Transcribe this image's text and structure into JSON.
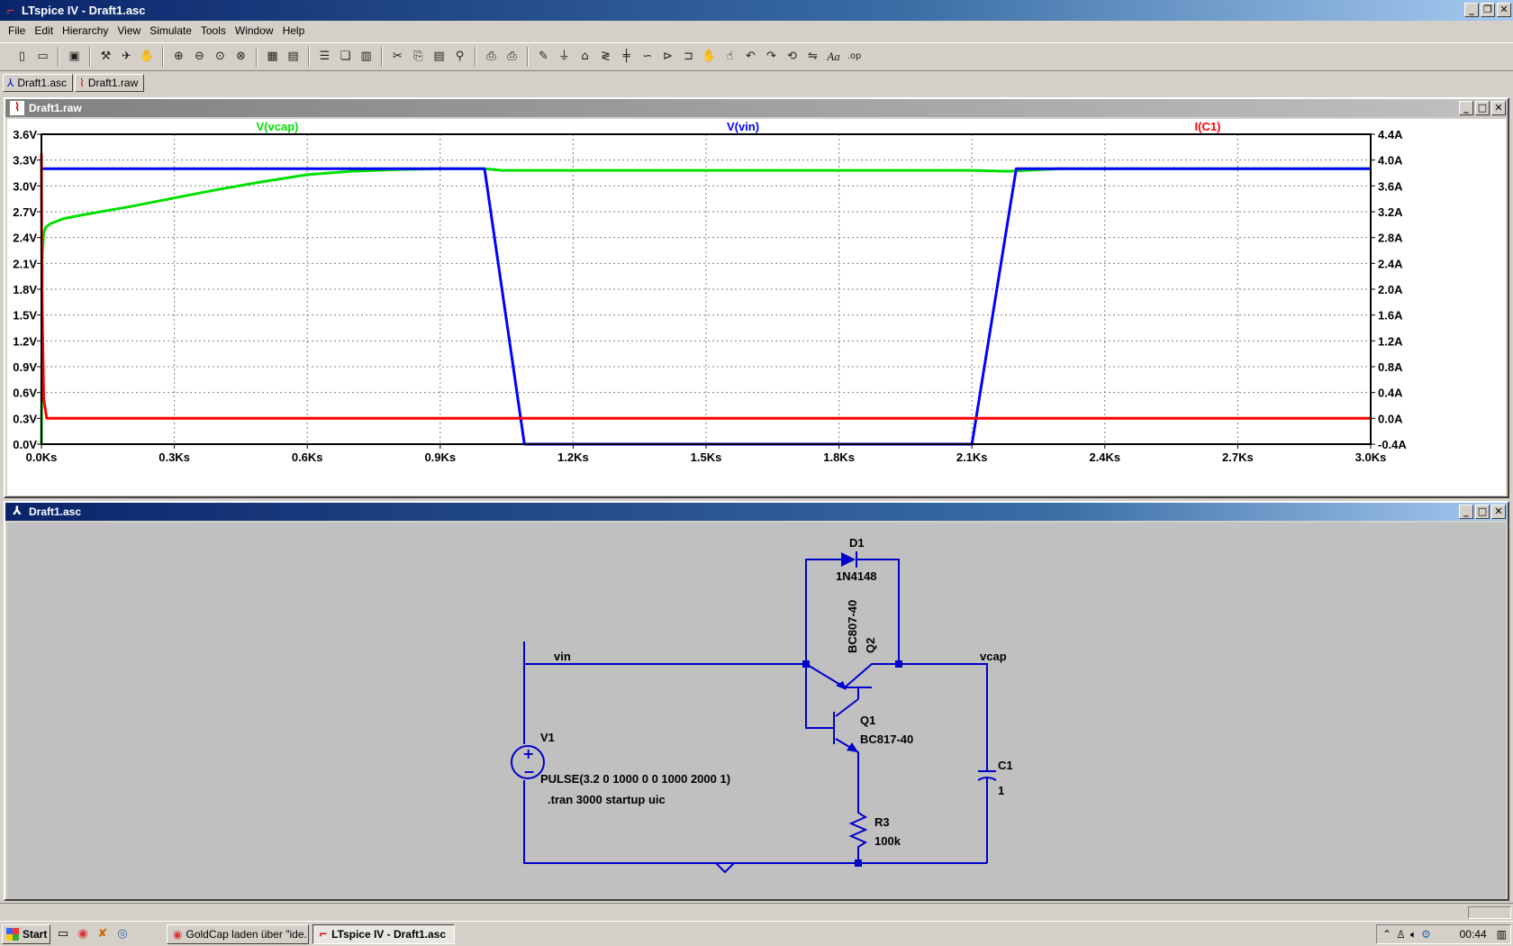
{
  "window": {
    "title": "LTspice IV - Draft1.asc"
  },
  "menu": [
    "File",
    "Edit",
    "Hierarchy",
    "View",
    "Simulate",
    "Tools",
    "Window",
    "Help"
  ],
  "toolbar_icons": [
    "new-schematic-icon",
    "open-icon",
    "save-icon",
    "control-panel-icon",
    "run-icon",
    "halt-icon",
    "zoom-in-icon",
    "zoom-out-icon",
    "zoom-area-icon",
    "zoom-cancel-icon",
    "autorange-icon",
    "markers-icon",
    "tile-horizontal-icon",
    "cascade-icon",
    "tile-vertical-icon",
    "cut-icon",
    "copy-icon",
    "paste-icon",
    "find-icon",
    "print-setup-icon",
    "print-icon",
    "wire-icon",
    "ground-icon",
    "label-net-icon",
    "resistor-icon",
    "capacitor-icon",
    "inductor-icon",
    "diode-icon",
    "component-icon",
    "move-icon",
    "drag-icon",
    "undo-icon",
    "redo-icon",
    "rotate-icon",
    "mirror-icon",
    "text-icon",
    "spice-directive-icon"
  ],
  "doc_tabs": [
    {
      "label": "Draft1.asc",
      "icon": "schematic-icon"
    },
    {
      "label": "Draft1.raw",
      "icon": "waveform-icon"
    }
  ],
  "plot_window": {
    "title": "Draft1.raw"
  },
  "schematic_window": {
    "title": "Draft1.asc"
  },
  "chart_data": {
    "type": "line",
    "x_ticks": [
      "0.0Ks",
      "0.3Ks",
      "0.6Ks",
      "0.9Ks",
      "1.2Ks",
      "1.5Ks",
      "1.8Ks",
      "2.1Ks",
      "2.4Ks",
      "2.7Ks",
      "3.0Ks"
    ],
    "xlim": [
      0,
      3000
    ],
    "y_left_ticks": [
      "0.0V",
      "0.3V",
      "0.6V",
      "0.9V",
      "1.2V",
      "1.5V",
      "1.8V",
      "2.1V",
      "2.4V",
      "2.7V",
      "3.0V",
      "3.3V",
      "3.6V"
    ],
    "ylim_left": [
      0,
      3.6
    ],
    "y_right_ticks": [
      "-0.4A",
      "0.0A",
      "0.4A",
      "0.8A",
      "1.2A",
      "1.6A",
      "2.0A",
      "2.4A",
      "2.8A",
      "3.2A",
      "3.6A",
      "4.0A",
      "4.4A"
    ],
    "ylim_right": [
      -0.4,
      4.4
    ],
    "series": [
      {
        "name": "V(vcap)",
        "color": "#00e000",
        "axis": "left",
        "x": [
          0,
          2,
          5,
          10,
          20,
          50,
          100,
          200,
          300,
          400,
          500,
          600,
          700,
          800,
          900,
          1000,
          1040,
          1200,
          1500,
          1800,
          2100,
          2180,
          2220,
          2300,
          2600,
          3000
        ],
        "y": [
          0.0,
          2.2,
          2.45,
          2.52,
          2.56,
          2.62,
          2.67,
          2.76,
          2.86,
          2.96,
          3.05,
          3.13,
          3.17,
          3.19,
          3.2,
          3.2,
          3.18,
          3.18,
          3.18,
          3.18,
          3.18,
          3.17,
          3.18,
          3.2,
          3.2,
          3.2
        ]
      },
      {
        "name": "V(vin)",
        "color": "#0000ff",
        "axis": "left",
        "x": [
          0,
          1000,
          1090,
          2090,
          2100,
          2200,
          3000
        ],
        "y": [
          3.2,
          3.2,
          0.0,
          0.0,
          0.0,
          3.2,
          3.2
        ]
      },
      {
        "name": "I(C1)",
        "color": "#ff0000",
        "axis": "right",
        "x": [
          0,
          1,
          5,
          12,
          3000
        ],
        "y": [
          4.1,
          2.0,
          0.3,
          0.0,
          0.0
        ]
      }
    ]
  },
  "schematic": {
    "components": {
      "D1": {
        "ref": "D1",
        "value": "1N4148"
      },
      "Q2": {
        "ref": "Q2",
        "value": "BC807-40"
      },
      "Q1": {
        "ref": "Q1",
        "value": "BC817-40"
      },
      "V1": {
        "ref": "V1",
        "value": "PULSE(3.2 0 1000 0 0 1000 2000 1)"
      },
      "C1": {
        "ref": "C1",
        "value": "1"
      },
      "R3": {
        "ref": "R3",
        "value": "100k"
      }
    },
    "nets": {
      "vin": "vin",
      "vcap": "vcap"
    },
    "directive": ".tran 3000 startup uic"
  },
  "taskbar": {
    "start": "Start",
    "tasks": [
      {
        "label": "GoldCap laden über \"ide...",
        "icon": "chrome-icon"
      },
      {
        "label": "LTspice IV - Draft1.asc",
        "icon": "ltspice-icon"
      }
    ],
    "clock": "00:44"
  }
}
